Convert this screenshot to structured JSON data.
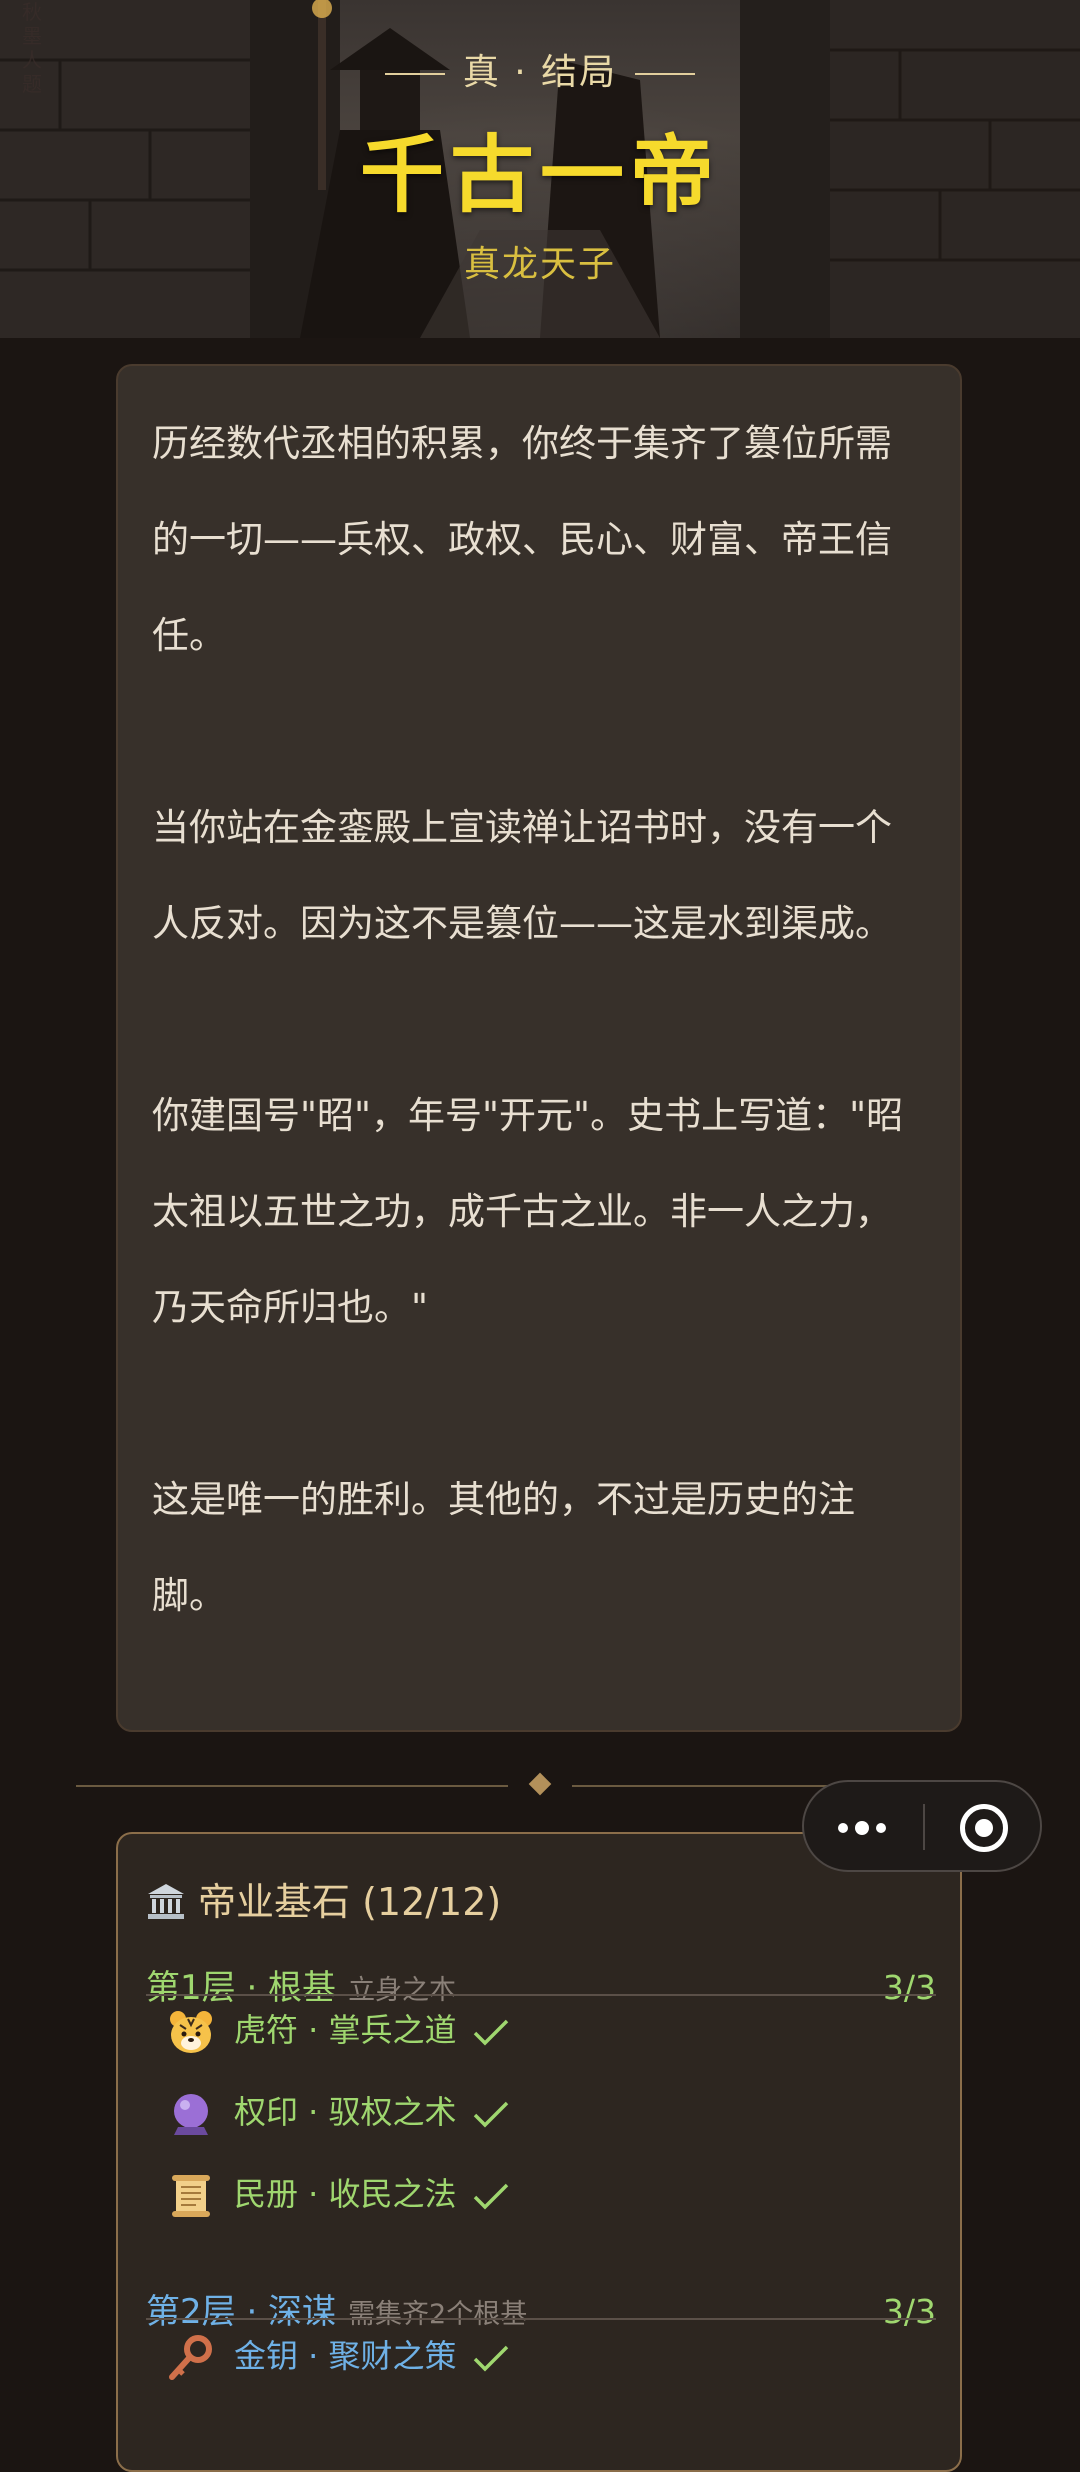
{
  "hero": {
    "ending_label": "真 · 结局",
    "title": "千古一帝",
    "subtitle": "真龙天子",
    "seal_text": "秋墨人题"
  },
  "story": {
    "paragraphs": [
      "历经数代丞相的积累，你终于集齐了篡位所需的一切——兵权、政权、民心、财富、帝王信任。",
      "当你站在金銮殿上宣读禅让诏书时，没有一个人反对。因为这不是篡位——这是水到渠成。",
      "你建国号\"昭\"，年号\"开元\"。史书上写道：\"昭太祖以五世之功，成千古之业。非一人之力，乃天命所归也。\"",
      "这是唯一的胜利。其他的，不过是历史的注脚。"
    ]
  },
  "capsule": {
    "more_icon": "more-dots-icon",
    "close_icon": "target-circle-icon"
  },
  "foundation": {
    "icon": "classical-building-icon",
    "title": "帝业基石 (12/12)",
    "tiers": [
      {
        "name": "第1层 · 根基",
        "requirement": "立身之本",
        "count": "3/3",
        "color": "#9fd76f",
        "items": [
          {
            "icon": "tiger-face-icon",
            "label": "虎符 · 掌兵之道",
            "done": true
          },
          {
            "icon": "crystal-ball-icon",
            "label": "权印 · 驭权之术",
            "done": true
          },
          {
            "icon": "scroll-icon",
            "label": "民册 · 收民之法",
            "done": true
          }
        ]
      },
      {
        "name": "第2层 · 深谋",
        "requirement": "需集齐2个根基",
        "count": "3/3",
        "color": "#6fb1e6",
        "items": [
          {
            "icon": "old-key-icon",
            "label": "金钥 · 聚财之策",
            "done": true
          }
        ]
      }
    ]
  },
  "colors": {
    "background": "#1b1512",
    "title_gold": "#f6da2c",
    "tier1_green": "#9fd76f",
    "tier2_blue": "#6fb1e6",
    "panel_border": "#8b6e4a"
  }
}
